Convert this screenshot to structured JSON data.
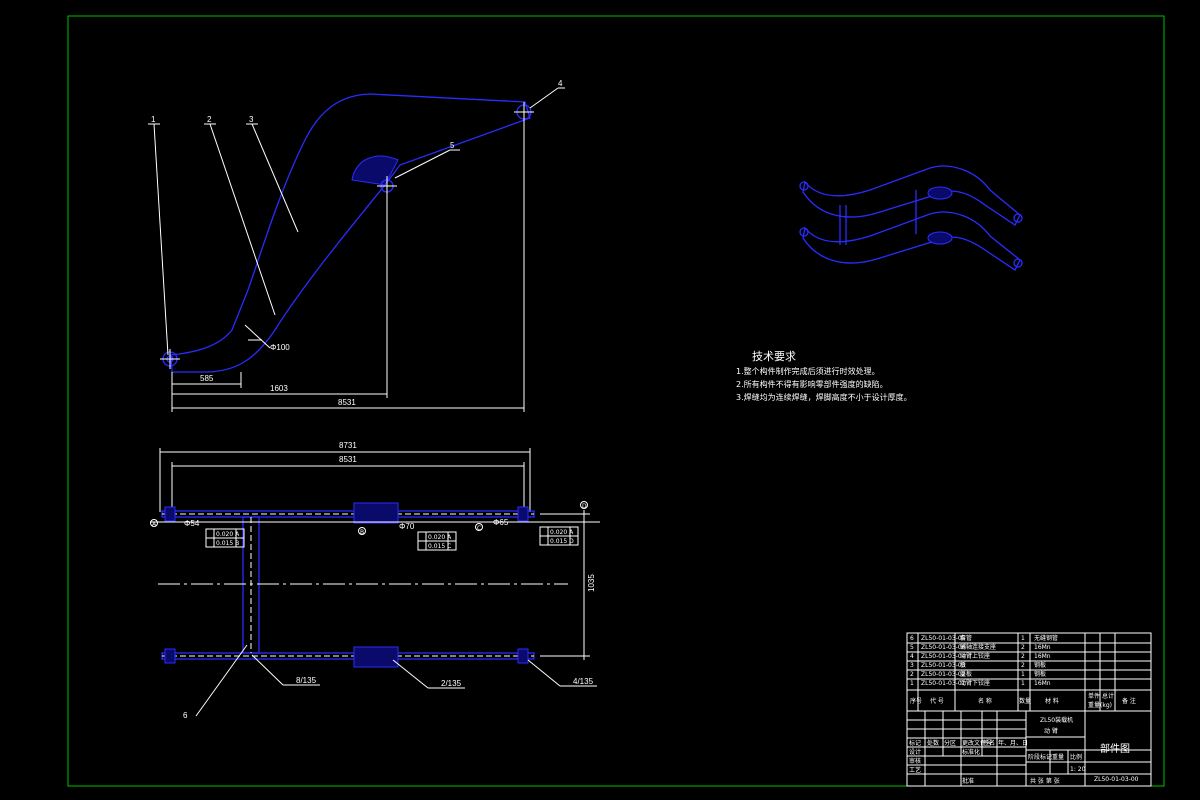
{
  "drawing": {
    "front_view": {
      "callouts": [
        "1",
        "2",
        "3",
        "4",
        "5"
      ],
      "dims": {
        "d1": "585",
        "d2": "1603",
        "d3": "8531",
        "phi": "Φ100"
      }
    },
    "top_view": {
      "dims": {
        "overall": "8731",
        "inner": "8531",
        "height": "1035",
        "phi54": "Φ54",
        "phi70": "Φ70",
        "phi65": "Φ65"
      },
      "tol_left": [
        "0.020 A",
        "0.015 B"
      ],
      "tol_mid": [
        "0.020 A",
        "0.015 C"
      ],
      "tol_right": [
        "0.020 A",
        "0.015 D"
      ],
      "datums": [
        "A",
        "B",
        "C",
        "D"
      ],
      "weld_labels": [
        "8/135",
        "2/135",
        "4/135"
      ],
      "callout6": "6"
    },
    "tech_req": {
      "title": "技术要求",
      "items": [
        "1.整个构件制作完成后须进行时效处理。",
        "2.所有构件不得有影响零部件强度的缺陷。",
        "3.焊缝均为连续焊缝，焊脚高度不小于设计厚度。"
      ]
    },
    "title_block": {
      "parts": [
        {
          "no": "6",
          "code": "ZL50-01-03-05",
          "name": "套管",
          "qty": "1",
          "mat": "无缝钢管"
        },
        {
          "no": "5",
          "code": "ZL50-01-03-06",
          "name": "销轴连接支座",
          "qty": "2",
          "mat": "16Mn"
        },
        {
          "no": "4",
          "code": "ZL50-01-03-04",
          "name": "动臂上铰座",
          "qty": "2",
          "mat": "16Mn"
        },
        {
          "no": "3",
          "code": "ZL50-01-03-03",
          "name": "板",
          "qty": "2",
          "mat": "钢板"
        },
        {
          "no": "2",
          "code": "ZL50-01-03-02",
          "name": "盖板",
          "qty": "1",
          "mat": "钢板"
        },
        {
          "no": "1",
          "code": "ZL50-01-03-01",
          "name": "动臂下铰座",
          "qty": "1",
          "mat": "16Mn"
        }
      ],
      "header": [
        "序号",
        "代 号",
        "名 称",
        "数量",
        "材 料",
        "单件",
        "总计",
        "备 注"
      ],
      "product": "ZL50装载机",
      "part_name": "动 臂",
      "doc_type": "部件图",
      "drawing_no": "ZL50-01-03-00",
      "sheet": "共 张 第 张",
      "scale": "1: 20",
      "labels": [
        "标记",
        "处数",
        "分区",
        "更改文件号",
        "签名",
        "年、月、日",
        "设计",
        "标准化",
        "审核",
        "工艺",
        "批准",
        "阶段标记",
        "重量",
        "比例",
        "重量(kg)"
      ]
    }
  }
}
